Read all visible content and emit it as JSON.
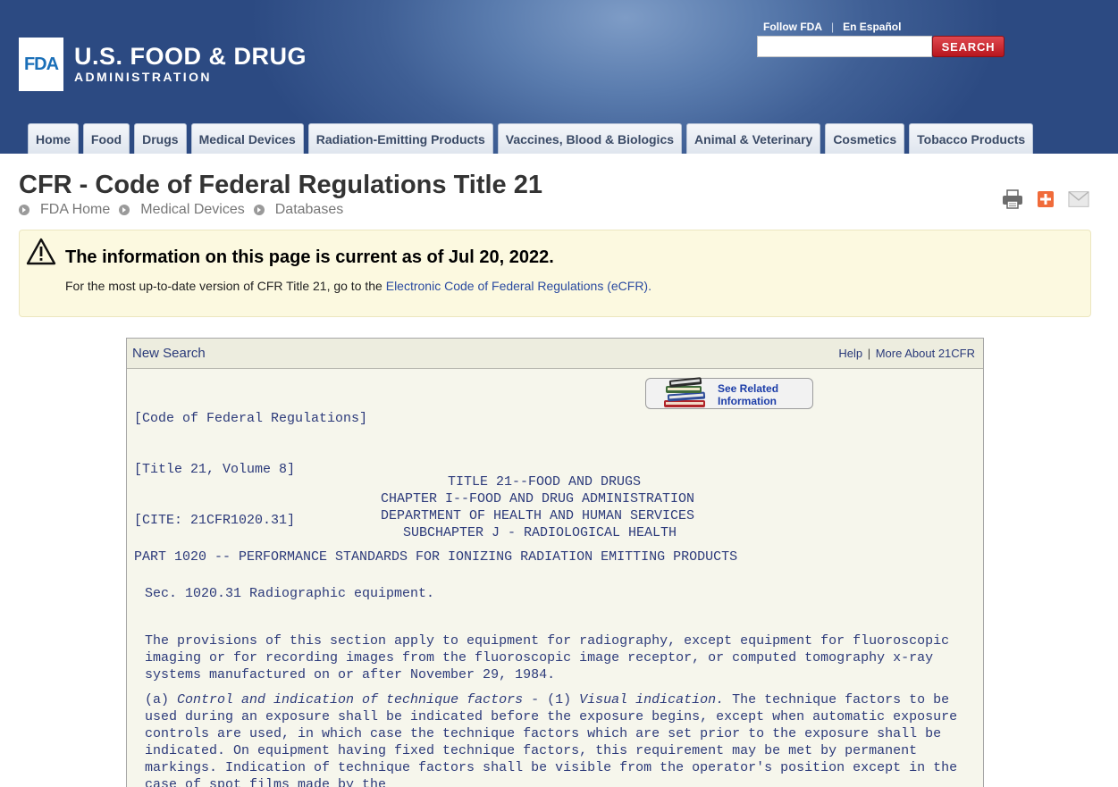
{
  "header": {
    "logo_mark": "FDA",
    "logo_main": "U.S. FOOD & DRUG",
    "logo_sub": "ADMINISTRATION",
    "follow_link": "Follow FDA",
    "spanish_link": "En Español",
    "search_button": "SEARCH",
    "search_placeholder": ""
  },
  "nav": {
    "tabs": [
      {
        "label": "Home"
      },
      {
        "label": "Food"
      },
      {
        "label": "Drugs"
      },
      {
        "label": "Medical Devices"
      },
      {
        "label": "Radiation-Emitting Products"
      },
      {
        "label": "Vaccines, Blood & Biologics"
      },
      {
        "label": "Animal & Veterinary"
      },
      {
        "label": "Cosmetics"
      },
      {
        "label": "Tobacco Products"
      }
    ]
  },
  "page": {
    "title": "CFR - Code of Federal Regulations Title 21",
    "breadcrumb": [
      {
        "label": "FDA Home"
      },
      {
        "label": "Medical Devices"
      },
      {
        "label": "Databases"
      }
    ],
    "tools": {
      "icons": [
        "print-icon",
        "add-share-icon",
        "email-icon"
      ]
    }
  },
  "notice": {
    "icon": "warning-icon",
    "title": "The information on this page is current as of Jul 20, 2022.",
    "text": "For the most up-to-date version of CFR Title 21, go to the ",
    "link": "Electronic Code of Federal Regulations (eCFR)."
  },
  "panel": {
    "new_search": "New Search",
    "help": "Help",
    "sep": "|",
    "more_about": "More About 21CFR",
    "cite_lines": [
      "[Code of Federal Regulations]",
      "[Title 21, Volume 8]",
      "[CITE: 21CFR1020.31]"
    ],
    "related_line1": "See Related",
    "related_line2": "Information",
    "headings": [
      "TITLE 21--FOOD AND DRUGS",
      "CHAPTER I--FOOD AND DRUG ADMINISTRATION",
      "DEPARTMENT OF HEALTH AND HUMAN SERVICES",
      "SUBCHAPTER J - RADIOLOGICAL HEALTH"
    ],
    "part": "PART 1020 -- PERFORMANCE STANDARDS FOR IONIZING RADIATION EMITTING PRODUCTS",
    "section": "Sec. 1020.31 Radiographic equipment.",
    "para1": "The provisions of this section apply to equipment for radiography, except equipment for fluoroscopic imaging or for recording images from the fluoroscopic image receptor, or computed tomography x-ray systems manufactured on or after November 29, 1984.",
    "para2_prefix": "(a) ",
    "para2_italic1": "Control and indication of technique factors",
    "para2_mid": " - (1) ",
    "para2_italic2": "Visual indication.",
    "para2_rest": " The technique factors to be used during an exposure shall be indicated before the exposure begins, except when automatic exposure controls are used, in which case the technique factors which are set prior to the exposure shall be indicated. On equipment having fixed technique factors, this requirement may be met by permanent markings. Indication of technique factors shall be visible from the operator's position except in the case of spot films made by the"
  }
}
